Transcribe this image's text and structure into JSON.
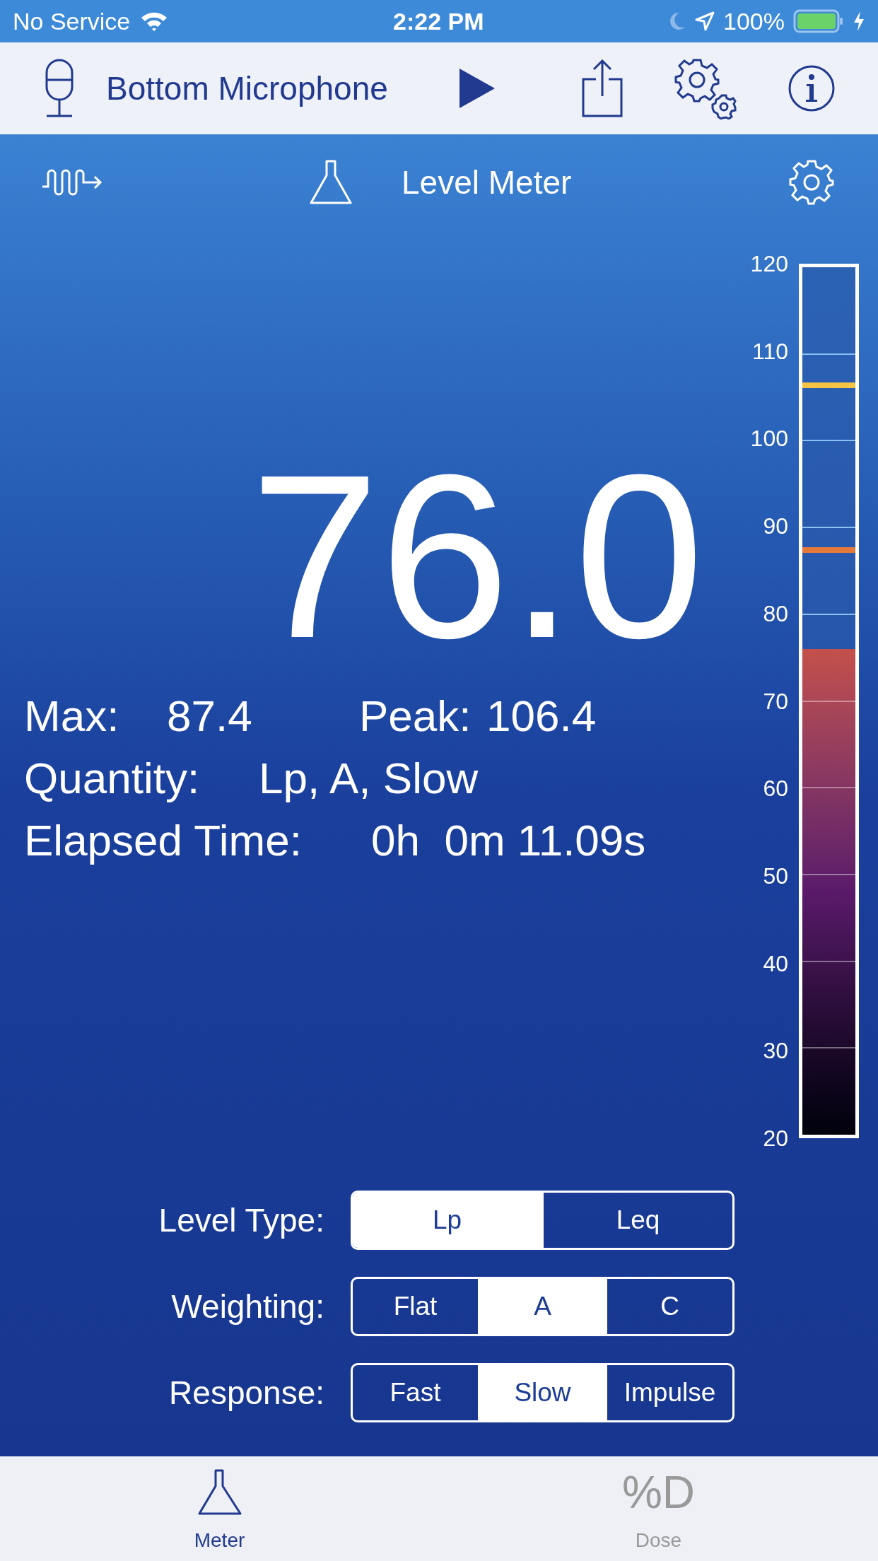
{
  "status_bar": {
    "carrier": "No Service",
    "time": "2:22 PM",
    "battery": "100%"
  },
  "toolbar": {
    "input": "Bottom Microphone"
  },
  "header": {
    "title": "Level Meter"
  },
  "reading": {
    "value": "76.0"
  },
  "stats": [
    {
      "label": "Max:",
      "value": "87.4"
    },
    {
      "label": "Peak:",
      "value": "106.4"
    }
  ],
  "quantity": {
    "label": "Quantity:",
    "value": "Lp, A, Slow"
  },
  "elapsed": {
    "label": "Elapsed Time:",
    "value": "0h  0m 11.09s"
  },
  "scale": {
    "ticks": [
      "120",
      "110",
      "100",
      "90",
      "80",
      "70",
      "60",
      "50",
      "40",
      "30",
      "20"
    ],
    "level": 0.56,
    "markers": [
      {
        "level": 0.864,
        "color": "#f5c445"
      },
      {
        "level": 0.674,
        "color": "#e5793a"
      }
    ]
  },
  "controls": [
    {
      "label": "Level Type:",
      "options": [
        {
          "label": "Lp",
          "selected": true
        },
        {
          "label": "Leq",
          "selected": false
        }
      ]
    },
    {
      "label": "Weighting:",
      "options": [
        {
          "label": "Flat",
          "selected": false
        },
        {
          "label": "A",
          "selected": true
        },
        {
          "label": "C",
          "selected": false
        }
      ]
    },
    {
      "label": "Response:",
      "options": [
        {
          "label": "Fast",
          "selected": false
        },
        {
          "label": "Slow",
          "selected": true
        },
        {
          "label": "Impulse",
          "selected": false
        }
      ]
    }
  ],
  "tab_bar": [
    {
      "kind": "flask",
      "label": "Meter",
      "selected": true
    },
    {
      "kind": "glyph",
      "glyph": "%D",
      "label": "Dose",
      "selected": false
    }
  ]
}
